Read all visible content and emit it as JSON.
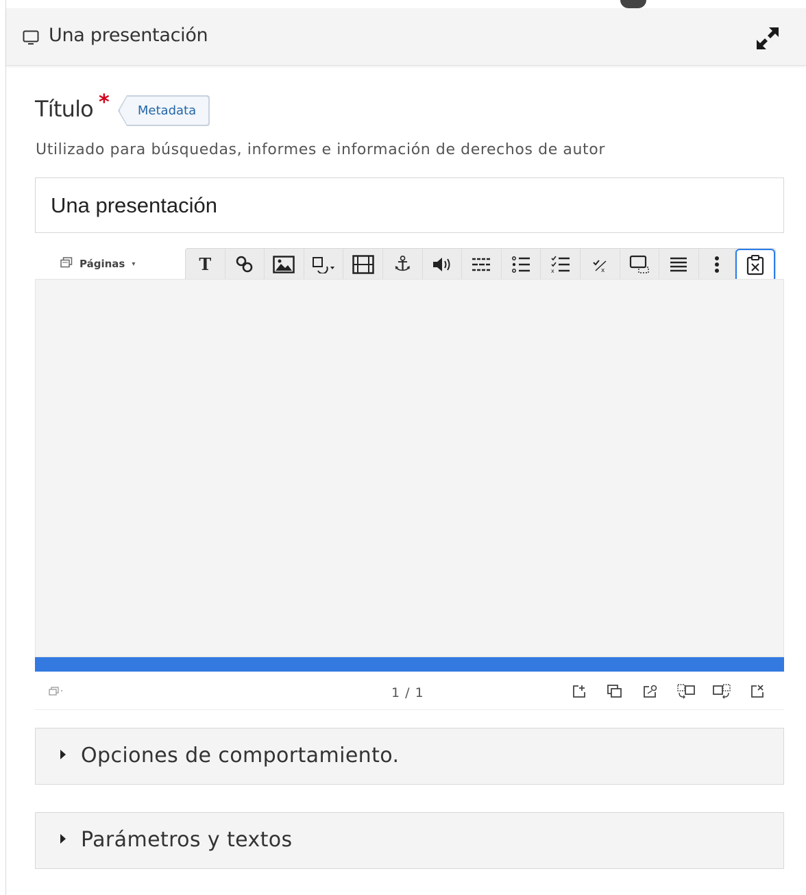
{
  "header": {
    "title": "Una presentación",
    "icon": "monitor-icon",
    "expand_icon": "expand-arrows-icon"
  },
  "title_field": {
    "label": "Título",
    "required_mark": "*",
    "metadata_button": "Metadata",
    "description": "Utilizado para búsquedas, informes e información de derechos de autor",
    "value": "Una presentación"
  },
  "editor": {
    "pages_dropdown": "Páginas",
    "toolbar": [
      "text-icon",
      "link-icon",
      "image-icon",
      "shapes-icon",
      "video-icon",
      "anchor-icon",
      "audio-icon",
      "fill-in-blanks-icon",
      "single-choice-icon",
      "multiple-choice-icon",
      "true-false-icon",
      "drag-drop-icon",
      "summary-icon",
      "more-icon",
      "paste-icon"
    ],
    "slide_counter": "1 / 1",
    "progress": 1.0,
    "slide_actions": [
      "new-slide-icon",
      "clone-slide-icon",
      "slide-background-icon",
      "move-slide-left-icon",
      "move-slide-right-icon",
      "delete-slide-icon"
    ]
  },
  "sections": {
    "behaviour": "Opciones de comportamiento.",
    "params": "Parámetros y textos"
  },
  "colors": {
    "accent": "#3379e0",
    "required": "#d0021b",
    "metadata_text": "#2266a8"
  }
}
